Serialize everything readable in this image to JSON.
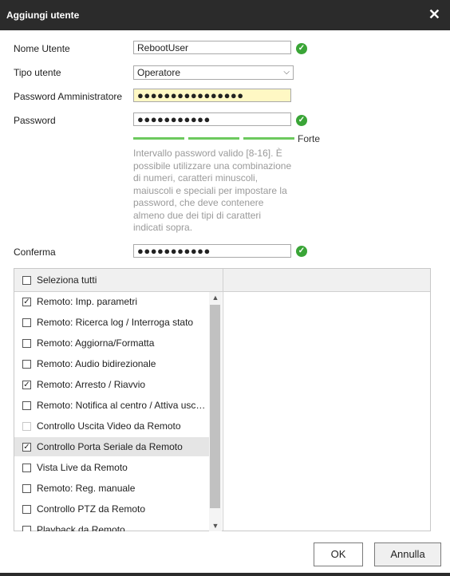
{
  "dialog": {
    "title": "Aggiungi utente",
    "close_icon": "close-icon"
  },
  "form": {
    "username_label": "Nome Utente",
    "username_value": "RebootUser",
    "user_type_label": "Tipo utente",
    "user_type_value": "Operatore",
    "admin_password_label": "Password Amministratore",
    "admin_password_value": "●●●●●●●●●●●●●●●●",
    "password_label": "Password",
    "password_value": "●●●●●●●●●●●",
    "strength_label": "Forte",
    "hint": "Intervallo password valido [8-16]. È possibile utilizzare una combinazione di numeri, caratteri minuscoli, maiuscoli e speciali per impostare la password, che deve contenere almeno due dei tipi di caratteri indicati sopra.",
    "confirm_label": "Conferma",
    "confirm_value": "●●●●●●●●●●●",
    "valid_icon": "check-circle-icon",
    "status_color": "#3aa537"
  },
  "permissions": {
    "select_all_label": "Seleziona tutti",
    "items": [
      {
        "label": "Remoto: Imp. parametri",
        "checked": true
      },
      {
        "label": "Remoto: Ricerca log / Interroga stato",
        "checked": false
      },
      {
        "label": "Remoto: Aggiorna/Formatta",
        "checked": false
      },
      {
        "label": "Remoto: Audio bidirezionale",
        "checked": false
      },
      {
        "label": "Remoto: Arresto / Riavvio",
        "checked": true
      },
      {
        "label": "Remoto: Notifica al centro / Attiva uscita allarme",
        "checked": false
      },
      {
        "label": "Controllo Uscita Video da Remoto",
        "checked": false,
        "disabled": true
      },
      {
        "label": "Controllo Porta Seriale da Remoto",
        "checked": true,
        "selected": true
      },
      {
        "label": "Vista Live da Remoto",
        "checked": false
      },
      {
        "label": "Remoto: Reg. manuale",
        "checked": false
      },
      {
        "label": "Controllo PTZ da Remoto",
        "checked": false
      },
      {
        "label": "Playback da Remoto",
        "checked": false
      }
    ]
  },
  "buttons": {
    "ok": "OK",
    "cancel": "Annulla"
  }
}
